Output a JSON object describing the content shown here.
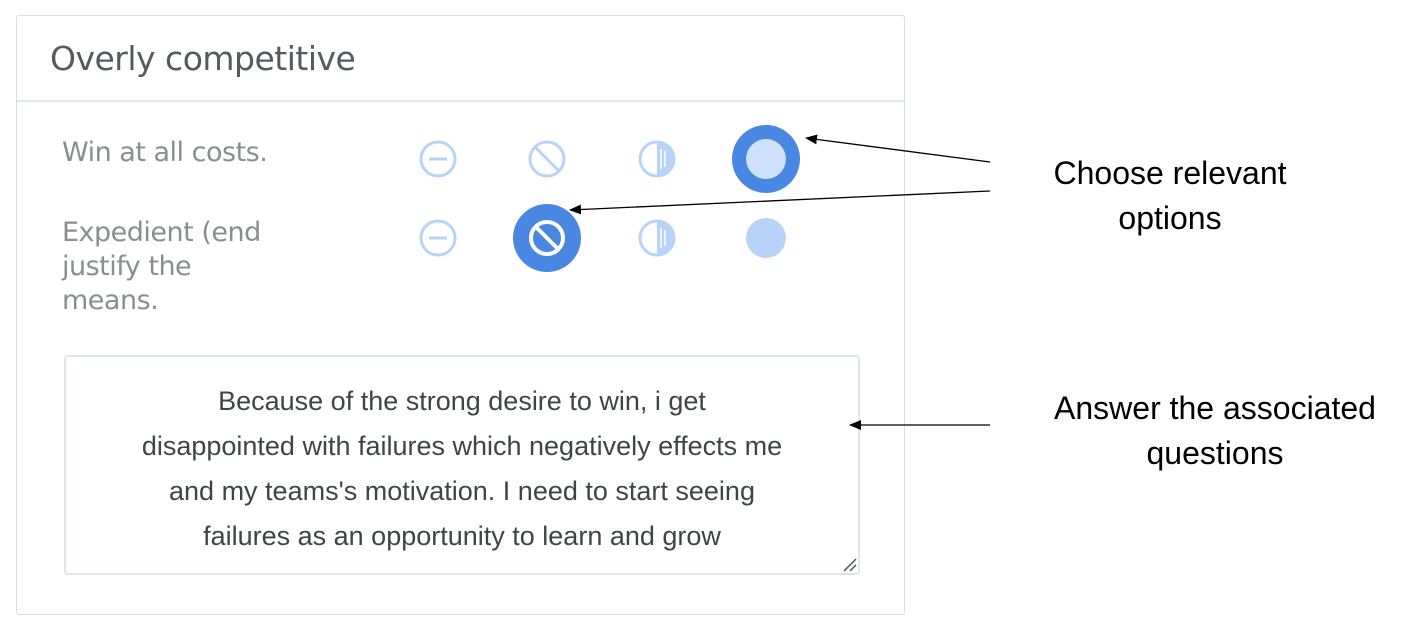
{
  "card": {
    "title": "Overly competitive",
    "rows": [
      {
        "label": "Win at all costs.",
        "selected_option": "full-circle"
      },
      {
        "label": "Expedient (end\njustify the\nmeans.",
        "selected_option": "no-entry"
      }
    ],
    "option_icons": [
      "minus-circle-icon",
      "no-entry-icon",
      "half-circle-icon",
      "full-circle-icon"
    ],
    "answer": "Because of the strong desire to win, i get\ndisappointed with failures which negatively effects me\nand my teams's motivation. I need to start seeing\nfailures as an opportunity to learn and grow"
  },
  "annotations": {
    "choose": "Choose relevant\noptions",
    "answer": "Answer the associated\nquestions"
  },
  "colors": {
    "accent": "#4a87e2",
    "icon_light": "#b9d2f7",
    "title_text": "#555a60",
    "label_text": "#8a8d91"
  }
}
